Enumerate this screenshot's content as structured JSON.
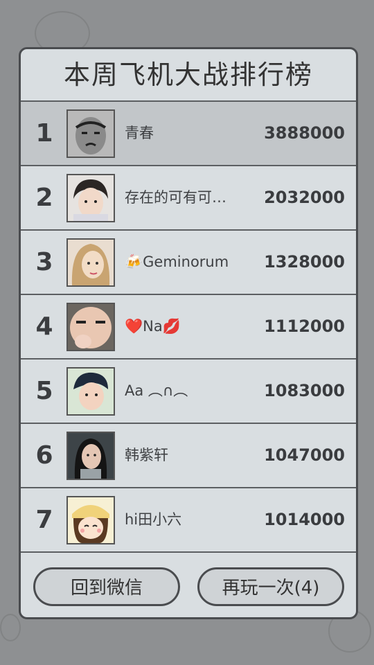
{
  "title": "本周飞机大战排行榜",
  "rankings": [
    {
      "rank": "1",
      "name": "青春",
      "score": "3888000",
      "avatar_icon": "user-avatar-icon"
    },
    {
      "rank": "2",
      "name": "存在的可有可…",
      "score": "2032000",
      "avatar_icon": "user-avatar-icon"
    },
    {
      "rank": "3",
      "name": "🍻Geminorum",
      "score": "1328000",
      "avatar_icon": "user-avatar-icon"
    },
    {
      "rank": "4",
      "name": "❤️Na💋",
      "score": "1112000",
      "avatar_icon": "user-avatar-icon"
    },
    {
      "rank": "5",
      "name": "Aa ︵∩︵",
      "score": "1083000",
      "avatar_icon": "user-avatar-icon"
    },
    {
      "rank": "6",
      "name": "韩紫轩",
      "score": "1047000",
      "avatar_icon": "user-avatar-icon"
    },
    {
      "rank": "7",
      "name": "hi田小六",
      "score": "1014000",
      "avatar_icon": "user-avatar-icon"
    }
  ],
  "buttons": {
    "back_label": "回到微信",
    "replay_label": "再玩一次(4)"
  },
  "colors": {
    "background": "#8e9092",
    "panel": "#d9dee1",
    "highlight_row": "#c2c6c9",
    "border": "#4a4c4f"
  }
}
